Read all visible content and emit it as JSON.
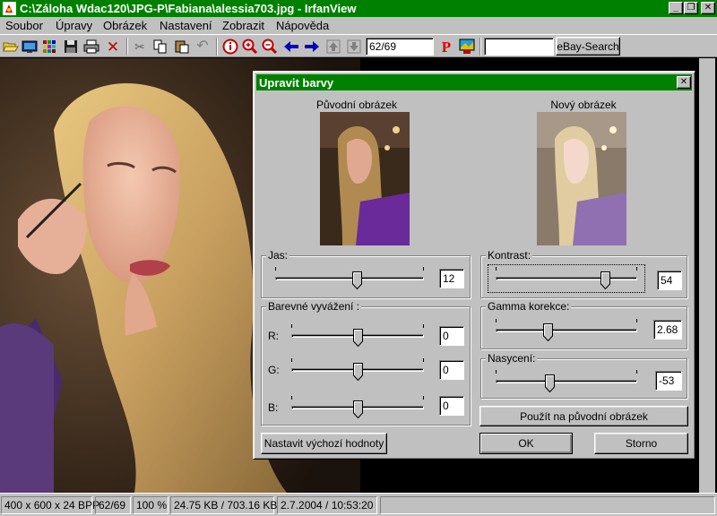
{
  "window": {
    "title": "C:\\Záloha Wdac120\\JPG-P\\Fabiana\\alessia703.jpg - IrfanView",
    "min_glyph": "_",
    "restore_glyph": "❐",
    "close_glyph": "✕"
  },
  "menu": [
    "Soubor",
    "Úpravy",
    "Obrázek",
    "Nastavení",
    "Zobrazit",
    "Nápověda"
  ],
  "toolbar": {
    "icons": [
      "open-icon",
      "slideshow-icon",
      "thumbnails-icon",
      "save-icon",
      "print-icon",
      "delete-icon",
      "cut-icon",
      "copy-icon",
      "paste-icon",
      "undo-icon",
      "info-icon",
      "zoom-in-icon",
      "zoom-out-icon",
      "previous-icon",
      "next-icon",
      "first-icon",
      "last-icon",
      "paint-icon",
      "screen-icon"
    ],
    "page_value": "62/69",
    "search_value": "",
    "ebay_label": "eBay-Search"
  },
  "dialog": {
    "title": "Upravit barvy",
    "original_label": "Původní obrázek",
    "new_label": "Nový obrázek",
    "brightness": {
      "label": "Jas:",
      "value": "12",
      "level": 0.55
    },
    "contrast": {
      "label": "Kontrast:",
      "value": "54",
      "level": 0.77
    },
    "balance": {
      "label": "Barevné vyvážení :",
      "r_label": "R:",
      "r_value": "0",
      "r_level": 0.5,
      "g_label": "G:",
      "g_value": "0",
      "g_level": 0.5,
      "b_label": "B:",
      "b_value": "0",
      "b_level": 0.5
    },
    "gamma": {
      "label": "Gamma korekce:",
      "value": "2.68",
      "level": 0.37
    },
    "saturation": {
      "label": "Nasycení:",
      "value": "-53",
      "level": 0.38
    },
    "apply_label": "Použít na původní obrázek",
    "defaults_label": "Nastavit výchozí hodnoty",
    "ok_label": "OK",
    "cancel_label": "Storno"
  },
  "status": {
    "dimensions": "400 x 600 x 24 BPP",
    "index": "62/69",
    "zoom": "100 %",
    "size": "24.75 KB / 703.16 KB",
    "date": "2.7.2004 / 10:53:20"
  },
  "colors": {
    "title_bar": "#008000",
    "face": "#c0c0c0"
  }
}
